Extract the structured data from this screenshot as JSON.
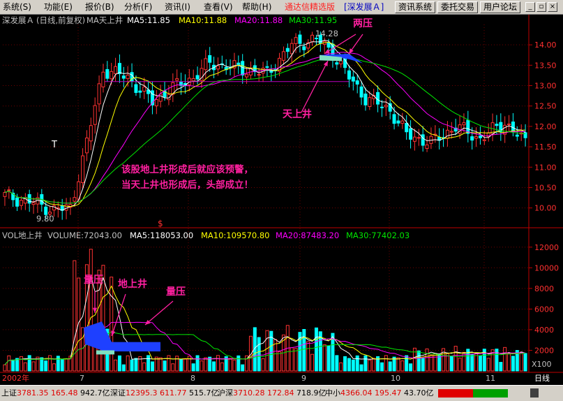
{
  "menu": {
    "items": [
      "系统(S)",
      "功能(E)",
      "报价(B)",
      "分析(F)",
      "资讯(I)",
      "查看(V)",
      "帮助(H)"
    ],
    "brand": "通达信精选版",
    "stock_tag": "[深发展Ａ]",
    "buttons": [
      "资讯系统",
      "委托交易",
      "用户论坛"
    ]
  },
  "price_panel": {
    "stock": "深发展Ａ",
    "period": "(日线,前复权)",
    "indicator": "MA天上井",
    "ma5": "MA5:11.85",
    "ma10": "MA10:11.88",
    "ma20": "MA20:11.88",
    "ma30": "MA30:11.95",
    "high_label": "14.28",
    "low_label": "9.80",
    "t_marker": "T",
    "s_marker": "$",
    "y_ticks": [
      "14.00",
      "13.50",
      "13.00",
      "12.50",
      "12.00",
      "11.50",
      "11.00",
      "10.50",
      "10.00"
    ],
    "annotation_top": "两压",
    "annotation_tianshangjing": "天上井",
    "warning_line1": "该股地上井形成后就应该预警，",
    "warning_line2": "当天上井也形成后，头部成立！"
  },
  "volume_panel": {
    "indicator": "VOL地上井",
    "volume": "VOLUME:72043.00",
    "ma5": "MA5:118053.00",
    "ma10": "MA10:109570.80",
    "ma20": "MA20:87483.20",
    "ma30": "MA30:77402.03",
    "y_ticks": [
      "12000",
      "10000",
      "8000",
      "6000",
      "4000",
      "2000"
    ],
    "multiplier": "X100",
    "annotation_left": "量压",
    "annotation_middle": "地上井",
    "annotation_right": "量压"
  },
  "time_axis": {
    "labels": [
      "2002年",
      "7",
      "8",
      "9",
      "10",
      "11"
    ],
    "period_label": "日线"
  },
  "status": {
    "sh_name": "上证",
    "sh_index": "3781.35",
    "sh_change": "165.48",
    "sh_amount": "942.7亿",
    "sz_name": "深证",
    "sz_index": "12395.3",
    "sz_change": "611.77",
    "sz_amount": "515.7亿",
    "hs_name": "沪深",
    "hs_index": "3710.28",
    "hs_change": "172.84",
    "hs_amount": "718.9亿",
    "zx_name": "中小",
    "zx_index": "4366.04",
    "zx_change": "195.47",
    "zx_amount": "43.70亿"
  },
  "colors": {
    "up": "#ff3232",
    "down": "#00ffff",
    "ma5": "#ffffff",
    "ma10": "#ffff00",
    "ma20": "#ff00ff",
    "ma30": "#00e600",
    "annotation": "#ff20a0"
  },
  "chart_data": {
    "type": "candlestick",
    "y_range": [
      9.6,
      14.5
    ],
    "volume_range": [
      0,
      13000
    ],
    "low_point": 9.8,
    "high_point": 14.28,
    "tianshangjing_level": 13.7,
    "volume_unit": "X100"
  }
}
